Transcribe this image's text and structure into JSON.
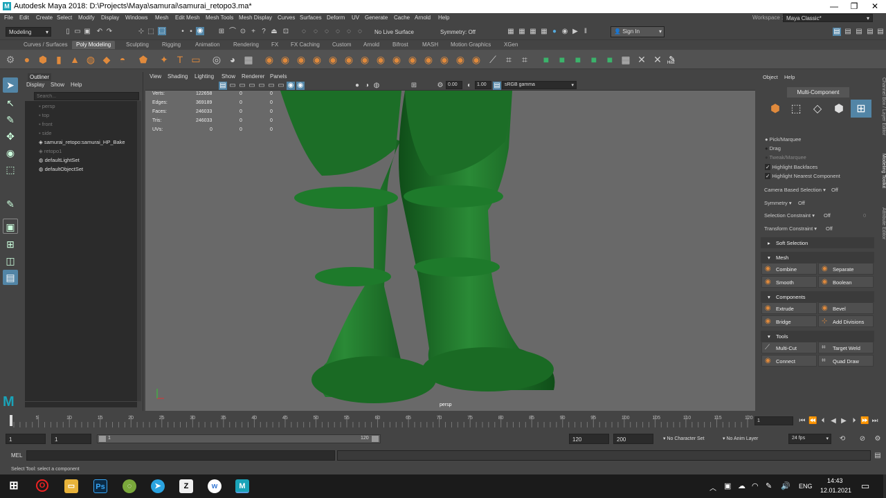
{
  "window": {
    "title": "Autodesk Maya 2018: D:\\Projects\\Maya\\samurai\\samurai_retopo3.ma*",
    "minimize": "—",
    "maximize": "❐",
    "close": "✕"
  },
  "menu": [
    "File",
    "Edit",
    "Create",
    "Select",
    "Modify",
    "Display",
    "Windows",
    "Mesh",
    "Edit Mesh",
    "Mesh Tools",
    "Mesh Display",
    "Curves",
    "Surfaces",
    "Deform",
    "UV",
    "Generate",
    "Cache",
    "Arnold",
    "Help"
  ],
  "workspace": {
    "label": "Workspace :",
    "value": "Maya Classic*"
  },
  "status": {
    "mode": "Modeling",
    "live_surface": "No Live Surface",
    "symmetry": "Symmetry: Off",
    "sign_in": "Sign In"
  },
  "shelf_tabs": [
    {
      "label": "Curves / Surfaces",
      "active": false
    },
    {
      "label": "Poly Modeling",
      "active": true
    },
    {
      "label": "Sculpting",
      "active": false
    },
    {
      "label": "Rigging",
      "active": false
    },
    {
      "label": "Animation",
      "active": false
    },
    {
      "label": "Rendering",
      "active": false
    },
    {
      "label": "FX",
      "active": false
    },
    {
      "label": "FX Caching",
      "active": false
    },
    {
      "label": "Custom",
      "active": false
    },
    {
      "label": "Arnold",
      "active": false
    },
    {
      "label": "Bifrost",
      "active": false
    },
    {
      "label": "MASH",
      "active": false
    },
    {
      "label": "Motion Graphics",
      "active": false
    },
    {
      "label": "XGen",
      "active": false
    }
  ],
  "shelf": {
    "hist": "Hist"
  },
  "outliner": {
    "title": "Outliner",
    "menu": [
      "Display",
      "Show",
      "Help"
    ],
    "search_placeholder": "Search...",
    "items": [
      {
        "label": "persp",
        "dim": true
      },
      {
        "label": "top",
        "dim": true
      },
      {
        "label": "front",
        "dim": true
      },
      {
        "label": "side",
        "dim": true
      },
      {
        "label": "samurai_retopo:samurai_HP_Bake",
        "dim": false
      },
      {
        "label": "retopo1",
        "dim": true
      },
      {
        "label": "defaultLightSet",
        "dim": false
      },
      {
        "label": "defaultObjectSet",
        "dim": false
      }
    ]
  },
  "viewport": {
    "menu": [
      "View",
      "Shading",
      "Lighting",
      "Show",
      "Renderer",
      "Panels"
    ],
    "exposure": "0.00",
    "gamma": "1.00",
    "color_space": "sRGB gamma",
    "camera": "persp",
    "hud": [
      {
        "label": "Verts:",
        "a": "122658",
        "b": "0",
        "c": "0"
      },
      {
        "label": "Edges:",
        "a": "369189",
        "b": "0",
        "c": "0"
      },
      {
        "label": "Faces:",
        "a": "246033",
        "b": "0",
        "c": "0"
      },
      {
        "label": "Tris:",
        "a": "246033",
        "b": "0",
        "c": "0"
      },
      {
        "label": "UVs:",
        "a": "0",
        "b": "0",
        "c": "0"
      }
    ]
  },
  "toolkit": {
    "menu": [
      "Object",
      "Help"
    ],
    "mode": "Multi-Component",
    "pick": [
      "Pick/Marquee",
      "Drag",
      "Tweak/Marquee"
    ],
    "checks": [
      {
        "label": "Highlight Backfaces",
        "checked": true
      },
      {
        "label": "Highlight Nearest Component",
        "checked": true
      }
    ],
    "options": [
      {
        "label": "Camera Based Selection",
        "value": "Off"
      },
      {
        "label": "Symmetry",
        "value": "Off"
      },
      {
        "label": "Selection Constraint",
        "value": "Off",
        "extra": "0"
      },
      {
        "label": "Transform Constraint",
        "value": "Off"
      }
    ],
    "soft_selection": "Soft Selection",
    "sections": [
      {
        "title": "Mesh",
        "buttons": [
          "Combine",
          "Separate",
          "Smooth",
          "Boolean"
        ]
      },
      {
        "title": "Components",
        "buttons": [
          "Extrude",
          "Bevel",
          "Bridge",
          "Add Divisions"
        ]
      },
      {
        "title": "Tools",
        "buttons": [
          "Multi-Cut",
          "Target Weld",
          "Connect",
          "Quad Draw"
        ]
      }
    ]
  },
  "side_tabs": [
    "Channel Box / Layer Editor",
    "Modeling Toolkit",
    "Attribute Editor"
  ],
  "timeline": {
    "ticks": [
      "5",
      "10",
      "15",
      "20",
      "25",
      "30",
      "35",
      "40",
      "45",
      "50",
      "55",
      "60",
      "65",
      "70",
      "75",
      "80",
      "85",
      "90",
      "95",
      "100",
      "105",
      "110",
      "115",
      "120"
    ],
    "first": "1",
    "current": "1"
  },
  "range": {
    "start": "1",
    "anim_start": "1",
    "slider_start": "1",
    "slider_end": "120",
    "end": "120",
    "anim_end": "200",
    "character_set": "No Character Set",
    "anim_layer": "No Anim Layer",
    "fps": "24 fps"
  },
  "mel": {
    "label": "MEL"
  },
  "help_line": "Select Tool: select a component",
  "taskbar": {
    "lang": "ENG",
    "time": "14:43",
    "date": "12.01.2021"
  },
  "colors": {
    "mesh": "#1f7a2a",
    "accent": "#5285a6",
    "viewport_bg": "#696969"
  }
}
